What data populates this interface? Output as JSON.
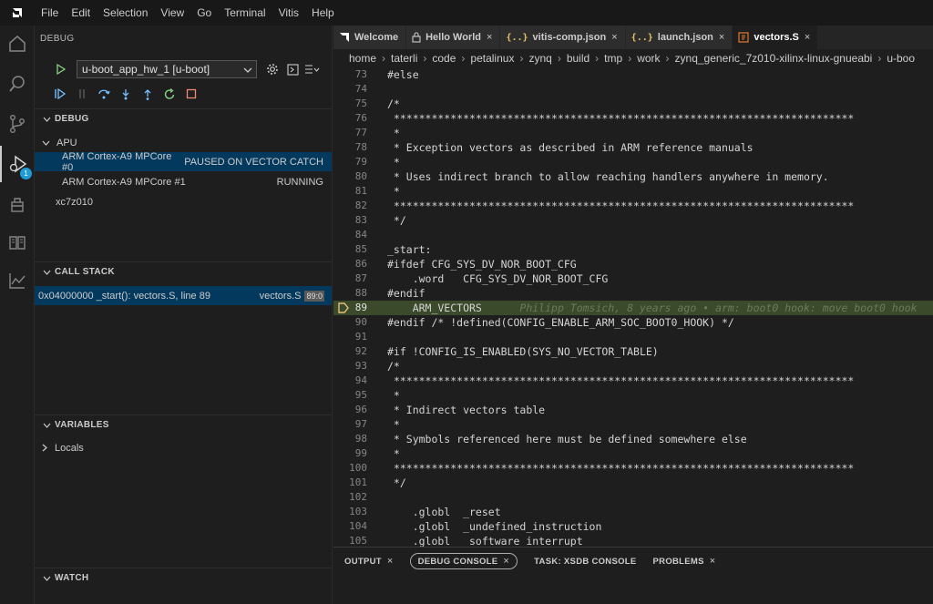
{
  "menu": [
    "File",
    "Edit",
    "Selection",
    "View",
    "Go",
    "Terminal",
    "Vitis",
    "Help"
  ],
  "activity": {
    "debug_badge": "1"
  },
  "sidebar": {
    "title": "DEBUG",
    "launch_config": "u-boot_app_hw_1 [u-boot]",
    "debug_section": {
      "header": "DEBUG",
      "group": "APU",
      "threads": [
        {
          "name": "ARM Cortex-A9 MPCore #0",
          "status": "PAUSED ON VECTOR CATCH"
        },
        {
          "name": "ARM Cortex-A9 MPCore #1",
          "status": "RUNNING"
        }
      ],
      "target": "xc7z010"
    },
    "call_stack": {
      "header": "CALL STACK",
      "frame": "0x04000000 _start(): vectors.S, line 89",
      "file": "vectors.S",
      "pos": "89:0"
    },
    "variables": {
      "header": "VARIABLES",
      "locals": "Locals"
    },
    "watch": {
      "header": "WATCH"
    }
  },
  "tabs": [
    {
      "label": "Welcome",
      "icon": "vitis-logo-icon",
      "closable": false,
      "active": false
    },
    {
      "label": "Hello World",
      "icon": "lock-icon",
      "closable": true,
      "active": false
    },
    {
      "label": "vitis-comp.json",
      "icon": "json-braces-icon",
      "closable": true,
      "active": false
    },
    {
      "label": "launch.json",
      "icon": "json-braces-icon",
      "closable": true,
      "active": false
    },
    {
      "label": "vectors.S",
      "icon": "asm-file-icon",
      "closable": true,
      "active": true
    }
  ],
  "breadcrumb": [
    "home",
    "taterli",
    "code",
    "petalinux",
    "zynq",
    "build",
    "tmp",
    "work",
    "zynq_generic_7z010-xilinx-linux-gnueabi",
    "u-boo"
  ],
  "code_lines": [
    {
      "n": "73",
      "t": "#else"
    },
    {
      "n": "74",
      "t": ""
    },
    {
      "n": "75",
      "t": "/*"
    },
    {
      "n": "76",
      "t": " *************************************************************************"
    },
    {
      "n": "77",
      "t": " *"
    },
    {
      "n": "78",
      "t": " * Exception vectors as described in ARM reference manuals"
    },
    {
      "n": "79",
      "t": " *"
    },
    {
      "n": "80",
      "t": " * Uses indirect branch to allow reaching handlers anywhere in memory."
    },
    {
      "n": "81",
      "t": " *"
    },
    {
      "n": "82",
      "t": " *************************************************************************"
    },
    {
      "n": "83",
      "t": " */"
    },
    {
      "n": "84",
      "t": ""
    },
    {
      "n": "85",
      "t": "_start:"
    },
    {
      "n": "86",
      "t": "#ifdef CFG_SYS_DV_NOR_BOOT_CFG"
    },
    {
      "n": "87",
      "t": "    .word   CFG_SYS_DV_NOR_BOOT_CFG"
    },
    {
      "n": "88",
      "t": "#endif"
    },
    {
      "n": "89",
      "t": "    ARM_VECTORS",
      "blame": "      Philipp Tomsich, 8 years ago • arm: boot0 hook: move boot0 hook"
    },
    {
      "n": "90",
      "t": "#endif /* !defined(CONFIG_ENABLE_ARM_SOC_BOOT0_HOOK) */"
    },
    {
      "n": "91",
      "t": ""
    },
    {
      "n": "92",
      "t": "#if !CONFIG_IS_ENABLED(SYS_NO_VECTOR_TABLE)"
    },
    {
      "n": "93",
      "t": "/*"
    },
    {
      "n": "94",
      "t": " *************************************************************************"
    },
    {
      "n": "95",
      "t": " *"
    },
    {
      "n": "96",
      "t": " * Indirect vectors table"
    },
    {
      "n": "97",
      "t": " *"
    },
    {
      "n": "98",
      "t": " * Symbols referenced here must be defined somewhere else"
    },
    {
      "n": "99",
      "t": " *"
    },
    {
      "n": "100",
      "t": " *************************************************************************"
    },
    {
      "n": "101",
      "t": " */"
    },
    {
      "n": "102",
      "t": ""
    },
    {
      "n": "103",
      "t": "    .globl  _reset"
    },
    {
      "n": "104",
      "t": "    .globl  _undefined_instruction"
    },
    {
      "n": "105",
      "t": "    .globl  _software_interrupt"
    }
  ],
  "current_line": "89",
  "panel_tabs": [
    {
      "label": "OUTPUT",
      "closable": true,
      "active": false
    },
    {
      "label": "DEBUG CONSOLE",
      "closable": true,
      "active": true
    },
    {
      "label": "TASK: XSDB CONSOLE",
      "closable": false,
      "active": false
    },
    {
      "label": "PROBLEMS",
      "closable": true,
      "active": false
    }
  ],
  "colors": {
    "accent": "#1f9cd5",
    "debug_green": "#89d185",
    "debug_blue": "#75beff",
    "current_line": "#3a4a2a"
  }
}
